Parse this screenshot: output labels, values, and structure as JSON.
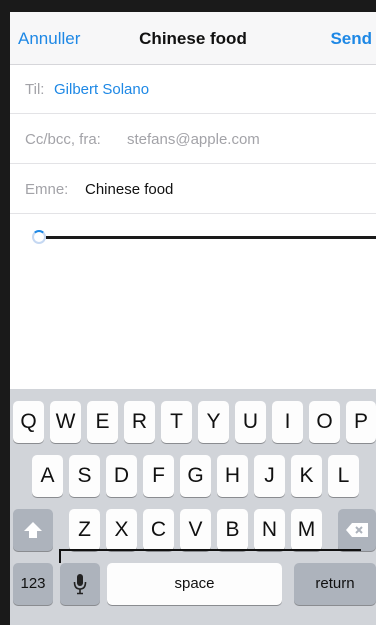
{
  "navbar": {
    "cancel_label": "Annuller",
    "title": "Chinese food",
    "send_label": "Send"
  },
  "fields": {
    "to_label": "Til:",
    "to_value": "Gilbert Solano",
    "cc_label": "Cc/bcc, fra:",
    "cc_value": "stefans@apple.com",
    "subject_label": "Emne:",
    "subject_value": "Chinese food"
  },
  "keyboard": {
    "row1": [
      "Q",
      "W",
      "E",
      "R",
      "T",
      "Y",
      "U",
      "I",
      "O",
      "P"
    ],
    "row2": [
      "A",
      "S",
      "D",
      "F",
      "G",
      "H",
      "J",
      "K",
      "L"
    ],
    "row3": [
      "Z",
      "X",
      "C",
      "V",
      "B",
      "N",
      "M"
    ],
    "numbers_label": "123",
    "space_label": "space",
    "return_label": "return",
    "shift_icon": "shift-arrow",
    "backspace_icon": "backspace",
    "mic_icon": "microphone"
  },
  "colors": {
    "accent": "#1e88e5",
    "keyboard_bg": "#d1d4d9",
    "key_dark": "#adb3bc"
  }
}
